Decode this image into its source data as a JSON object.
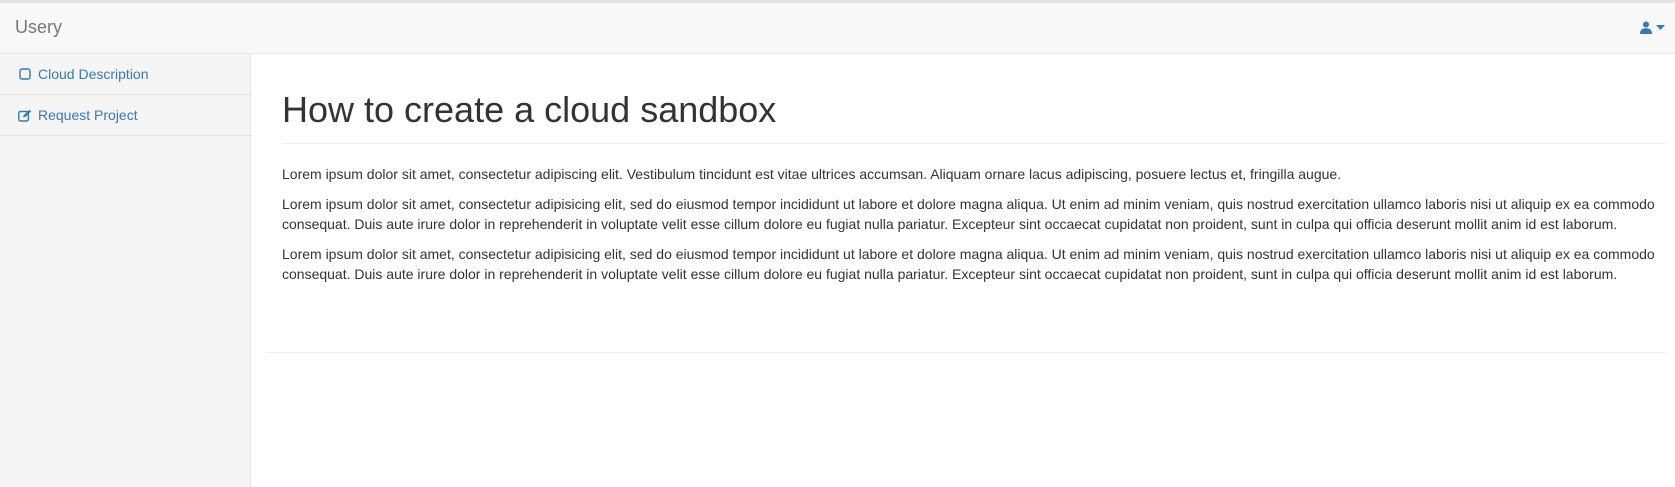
{
  "navbar": {
    "brand": "Usery",
    "user_icon": "user-icon",
    "caret_icon": "caret-down-icon"
  },
  "sidebar": {
    "items": [
      {
        "label": "Cloud Description",
        "icon": "square-outline-icon"
      },
      {
        "label": "Request Project",
        "icon": "edit-icon"
      }
    ]
  },
  "main": {
    "title": "How to create a cloud sandbox",
    "paragraphs": [
      "Lorem ipsum dolor sit amet, consectetur adipiscing elit. Vestibulum tincidunt est vitae ultrices accumsan. Aliquam ornare lacus adipiscing, posuere lectus et, fringilla augue.",
      "Lorem ipsum dolor sit amet, consectetur adipisicing elit, sed do eiusmod tempor incididunt ut labore et dolore magna aliqua. Ut enim ad minim veniam, quis nostrud exercitation ullamco laboris nisi ut aliquip ex ea commodo consequat. Duis aute irure dolor in reprehenderit in voluptate velit esse cillum dolore eu fugiat nulla pariatur. Excepteur sint occaecat cupidatat non proident, sunt in culpa qui officia deserunt mollit anim id est laborum.",
      "Lorem ipsum dolor sit amet, consectetur adipisicing elit, sed do eiusmod tempor incididunt ut labore et dolore magna aliqua. Ut enim ad minim veniam, quis nostrud exercitation ullamco laboris nisi ut aliquip ex ea commodo consequat. Duis aute irure dolor in reprehenderit in voluptate velit esse cillum dolore eu fugiat nulla pariatur. Excepteur sint occaecat cupidatat non proident, sunt in culpa qui officia deserunt mollit anim id est laborum."
    ]
  },
  "colors": {
    "link": "#337ab7",
    "navbar_bg": "#f8f8f8",
    "sidebar_bg": "#f5f5f5",
    "brand_text": "#777777",
    "body_text": "#333333"
  }
}
